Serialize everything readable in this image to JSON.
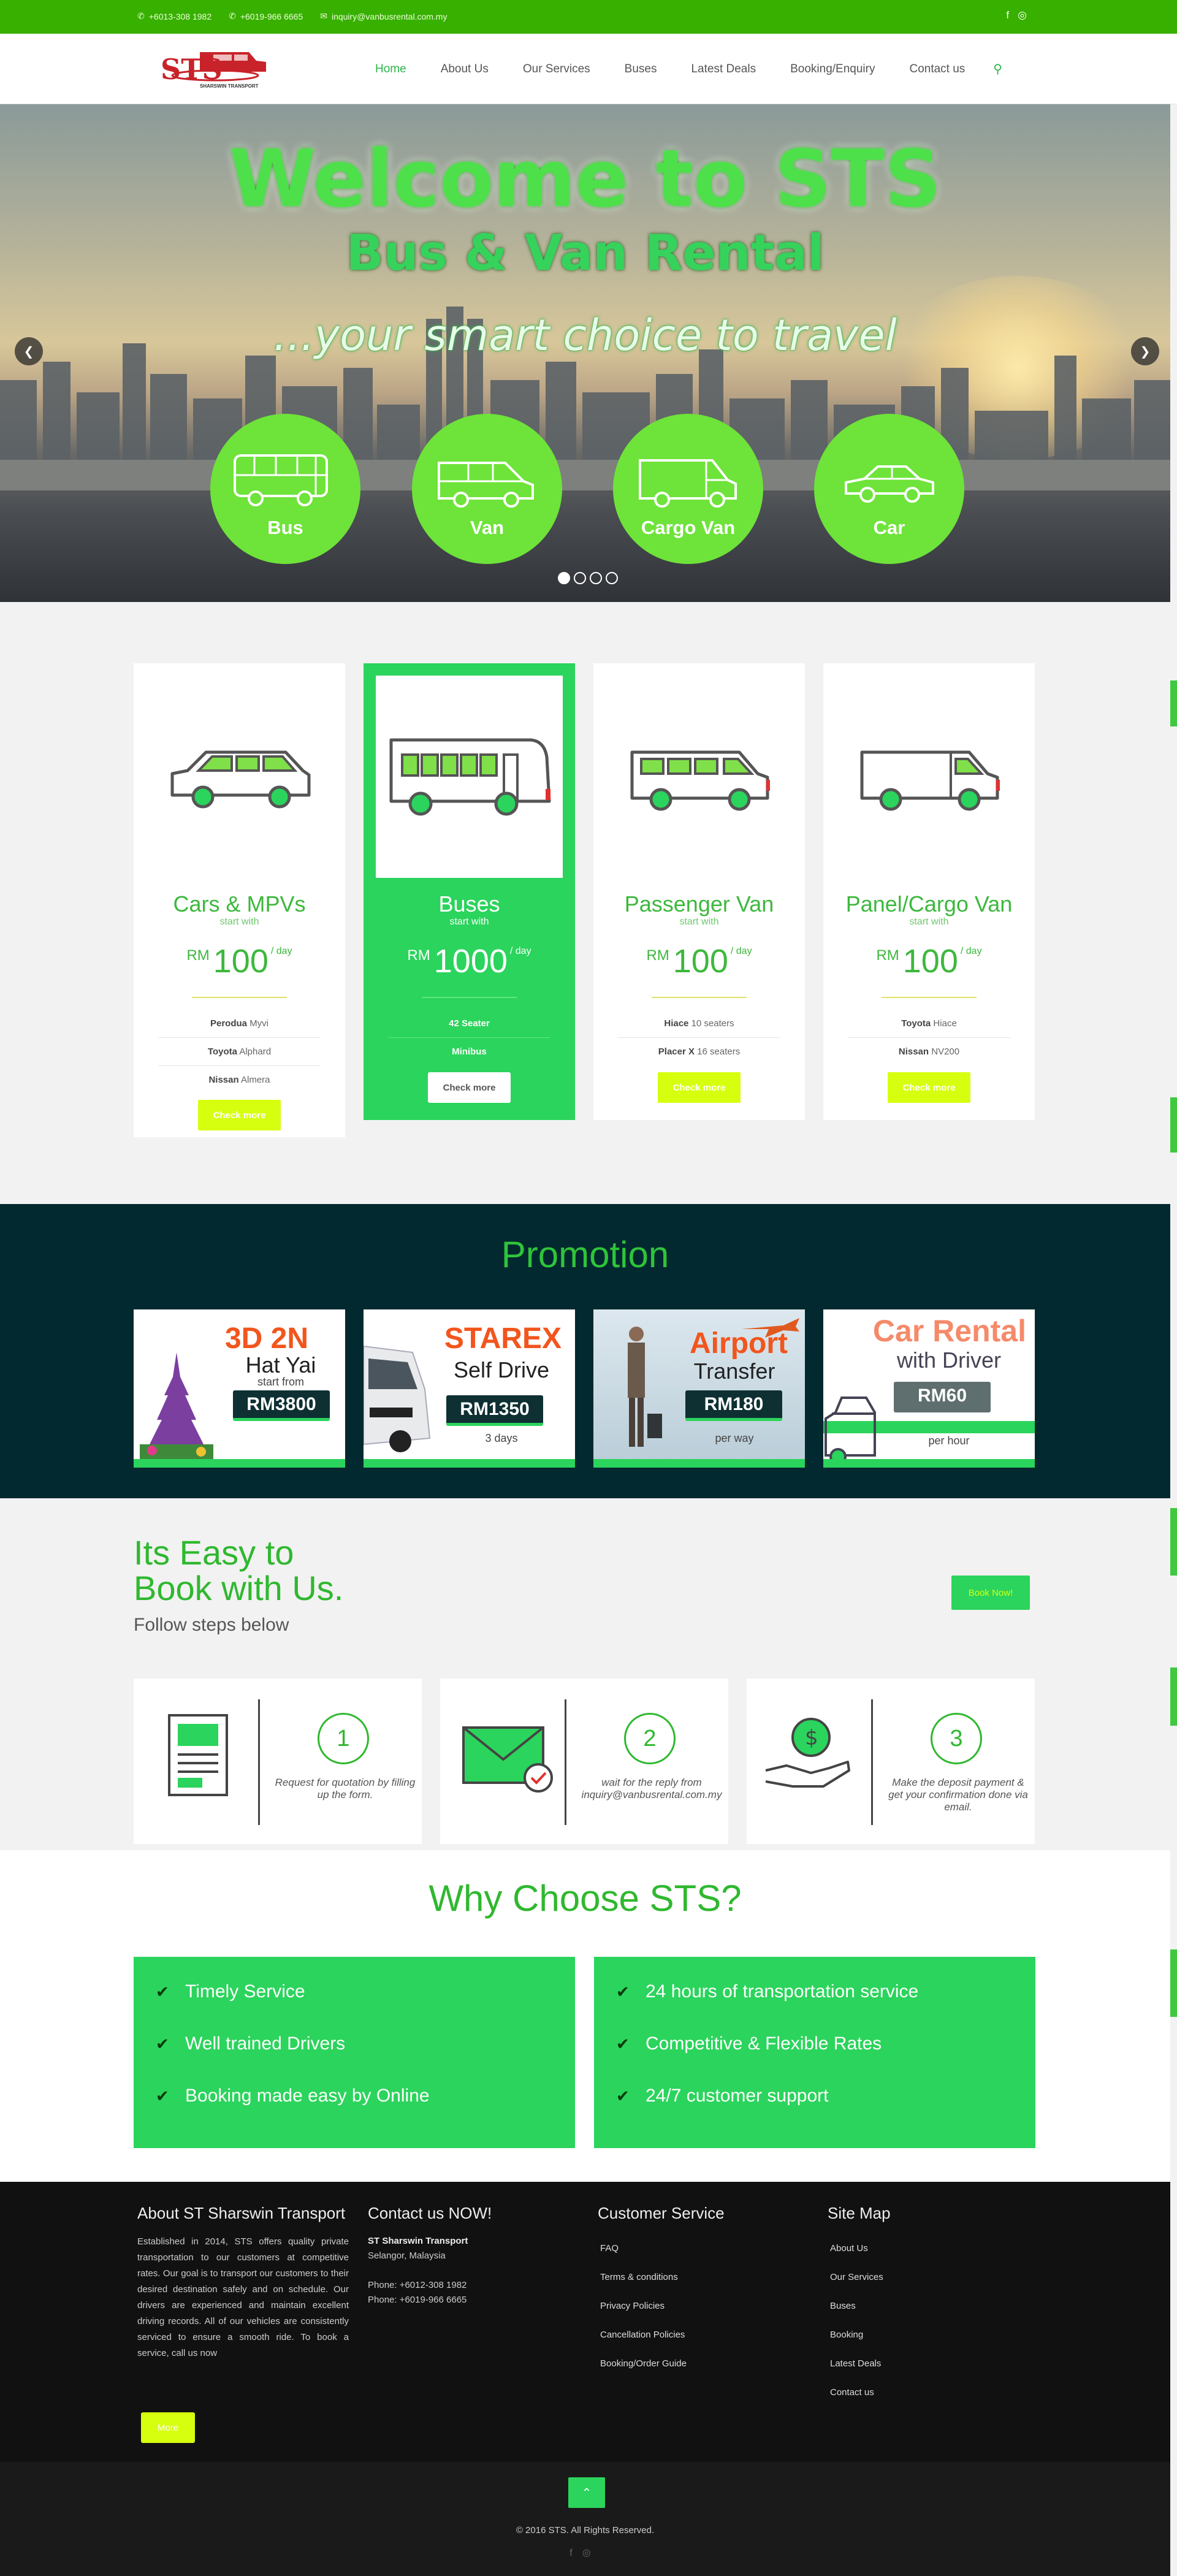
{
  "topbar": {
    "phone1": "+6013-308 1982",
    "phone2": "+6019-966 6665",
    "email": "inquiry@vanbusrental.com.my",
    "social": [
      "facebook-icon",
      "instagram-icon"
    ]
  },
  "header": {
    "logo_text": "STS",
    "logo_sub": "SHARSWIN TRANSPORT",
    "nav": [
      {
        "label": "Home",
        "active": true
      },
      {
        "label": "About Us",
        "active": false
      },
      {
        "label": "Our Services",
        "active": false
      },
      {
        "label": "Buses",
        "active": false
      },
      {
        "label": "Latest Deals",
        "active": false
      },
      {
        "label": "Booking/Enquiry",
        "active": false
      },
      {
        "label": "Contact us",
        "active": false
      }
    ]
  },
  "hero": {
    "title": "Welcome to STS",
    "subtitle": "Bus & Van Rental",
    "tagline": "...your smart choice to travel",
    "circles": [
      "Bus",
      "Van",
      "Cargo Van",
      "Car"
    ],
    "slides": 4,
    "active_slide": 1
  },
  "pricing": [
    {
      "name": "Cars & MPVs",
      "start": "start with",
      "currency": "RM",
      "price": "100",
      "per": "/ day",
      "items": [
        {
          "b": "Perodua",
          "t": " Myvi"
        },
        {
          "b": "Toyota",
          "t": " Alphard"
        },
        {
          "b": "Nissan",
          "t": " Almera"
        }
      ],
      "button": "Check more",
      "highlight": false
    },
    {
      "name": "Buses",
      "start": "start with",
      "currency": "RM",
      "price": "1000",
      "per": "/ day",
      "items": [
        {
          "b": "42 Seater",
          "t": ""
        },
        {
          "b": "Minibus",
          "t": ""
        }
      ],
      "button": "Check more",
      "highlight": true
    },
    {
      "name": "Passenger Van",
      "start": "start with",
      "currency": "RM",
      "price": "100",
      "per": "/ day",
      "items": [
        {
          "b": "Hiace",
          "t": " 10 seaters"
        },
        {
          "b": "Placer X",
          "t": " 16 seaters"
        }
      ],
      "button": "Check more",
      "highlight": false
    },
    {
      "name": "Panel/Cargo Van",
      "start": "start with",
      "currency": "RM",
      "price": "100",
      "per": "/ day",
      "items": [
        {
          "b": "Toyota",
          "t": " Hiace"
        },
        {
          "b": "Nissan",
          "t": " NV200"
        }
      ],
      "button": "Check more",
      "highlight": false
    }
  ],
  "promotion": {
    "title": "Promotion",
    "cards": [
      {
        "h1": "3D 2N",
        "h2": "Hat Yai",
        "small": "start from",
        "price": "RM3800"
      },
      {
        "h1": "STAREX",
        "h2": "Self Drive",
        "small": "3 days",
        "price": "RM1350"
      },
      {
        "h1": "Airport",
        "h2": "Transfer",
        "small": "per way",
        "price": "RM180"
      },
      {
        "h1": "Car Rental",
        "h2": "with Driver",
        "small": "per hour",
        "price": "RM60"
      }
    ]
  },
  "easy": {
    "title_line1": "Its Easy to",
    "title_line2": "Book with Us.",
    "subtitle": "Follow steps below",
    "button": "Book Now!",
    "steps": [
      {
        "num": "1",
        "text": "Request for quotation by filling up the form."
      },
      {
        "num": "2",
        "text": "wait for the reply from inquiry@vanbusrental.com.my"
      },
      {
        "num": "3",
        "text": "Make the deposit payment & get your confirmation done via email."
      }
    ]
  },
  "why": {
    "title": "Why Choose STS?",
    "left": [
      "Timely Service",
      "Well trained Drivers",
      "Booking made easy by Online"
    ],
    "right": [
      "24 hours of transportation service",
      "Competitive & Flexible Rates",
      "24/7 customer support"
    ]
  },
  "footer": {
    "about_title": "About ST Sharswin Transport",
    "about_text": "Established in 2014, STS offers quality private transportation to our customers at competitive rates. Our goal is to transport our customers to their desired destination safely and on schedule. Our drivers are experienced and maintain excellent driving records. All of our vehicles are consistently serviced to ensure a smooth ride. To book a service, call us now",
    "more": "More",
    "contact_title": "Contact us NOW!",
    "company": "ST Sharswin Transport",
    "location": "Selangor, Malaysia",
    "phone1": "Phone: +6012-308 1982",
    "phone2": "Phone: +6019-966 6665",
    "cs_title": "Customer Service",
    "cs_links": [
      "FAQ",
      "Terms & conditions",
      "Privacy Policies",
      "Cancellation Policies",
      "Booking/Order Guide"
    ],
    "map_title": "Site Map",
    "map_links": [
      "About Us",
      "Our Services",
      "Buses",
      "Booking",
      "Latest Deals",
      "Contact us"
    ],
    "copyright": "© 2016 STS. All Rights Reserved."
  }
}
